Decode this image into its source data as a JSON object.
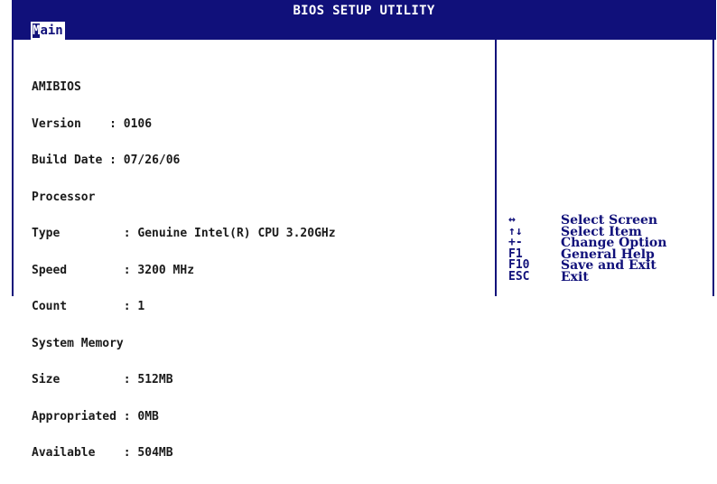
{
  "header": {
    "title": "BIOS SETUP UTILITY",
    "active_tab_first": "M",
    "active_tab_rest": "ain"
  },
  "colors": {
    "bios_blue": "#10107a",
    "text_dark": "#1a1a1a",
    "background": "#ffffff"
  },
  "system_info": {
    "bios_heading": "AMIBIOS",
    "version_label": "Version",
    "version_value": "0106",
    "build_date_label": "Build Date",
    "build_date_value": "07/26/06",
    "processor_heading": "Processor",
    "type_label": "Type",
    "type_value": "Genuine Intel(R) CPU 3.20GHz",
    "speed_label": "Speed",
    "speed_value": "3200 MHz",
    "count_label": "Count",
    "count_value": "1",
    "memory_heading": "System Memory",
    "size_label": "Size",
    "size_value": "512MB",
    "appropriated_label": "Appropriated",
    "appropriated_value": "0MB",
    "available_label": "Available",
    "available_value": "504MB"
  },
  "help": {
    "items": [
      {
        "key": "↔",
        "desc": "Select Screen"
      },
      {
        "key": "↑↓",
        "desc": "Select Item"
      },
      {
        "key": "+-",
        "desc": "Change Option"
      },
      {
        "key": "F1",
        "desc": "General Help"
      },
      {
        "key": "F10",
        "desc": "Save and Exit"
      },
      {
        "key": "ESC",
        "desc": "Exit"
      }
    ]
  }
}
